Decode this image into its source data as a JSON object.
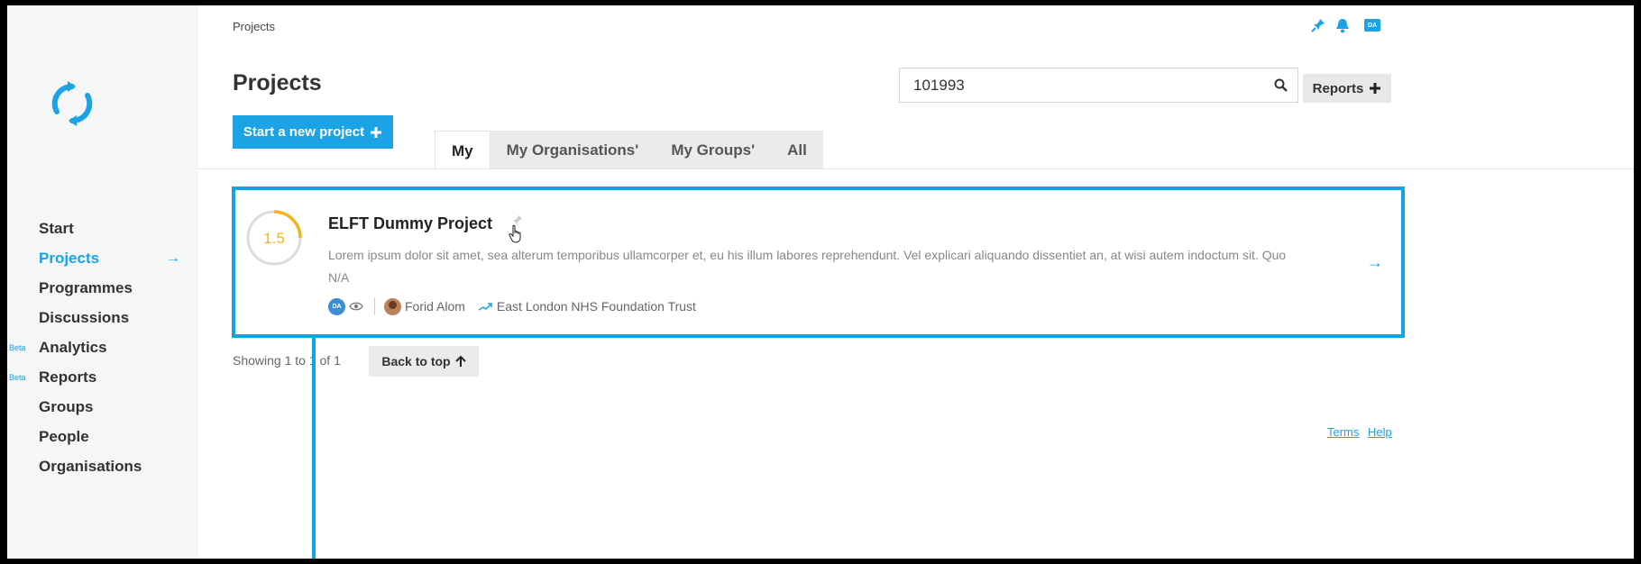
{
  "breadcrumb": "Projects",
  "header": {
    "title": "Projects",
    "user_initials": "DA",
    "new_project_label": "Start a new project",
    "reports_label": "Reports"
  },
  "search": {
    "value": "101993"
  },
  "sidebar": {
    "items": [
      {
        "label": "Start"
      },
      {
        "label": "Projects",
        "active": true
      },
      {
        "label": "Programmes"
      },
      {
        "label": "Discussions"
      },
      {
        "label": "Analytics",
        "badge": "Beta"
      },
      {
        "label": "Reports",
        "badge": "Beta"
      },
      {
        "label": "Groups"
      },
      {
        "label": "People"
      },
      {
        "label": "Organisations"
      }
    ]
  },
  "tabs": [
    {
      "label": "My",
      "active": true
    },
    {
      "label": "My Organisations'"
    },
    {
      "label": "My Groups'"
    },
    {
      "label": "All"
    }
  ],
  "project": {
    "score": "1.5",
    "score_fraction": 0.25,
    "title": "ELFT Dummy Project",
    "description": "Lorem ipsum dolor sit amet, sea alterum temporibus ullamcorper et, eu his illum labores reprehendunt. Vel explicari aliquando dissentiet an, at wisi autem indoctum sit. Quo",
    "status": "N/A",
    "owner_initials": "DA",
    "person": "Forid Alom",
    "organisation": "East London NHS Foundation Trust"
  },
  "pagination": {
    "showing": "Showing 1 to 1 of 1",
    "back_to_top": "Back to top"
  },
  "footer": {
    "terms": "Terms",
    "help": "Help"
  },
  "colors": {
    "accent": "#1ba3e6",
    "score_ring": "#f5b31c",
    "highlight_border": "#12a3e3"
  }
}
